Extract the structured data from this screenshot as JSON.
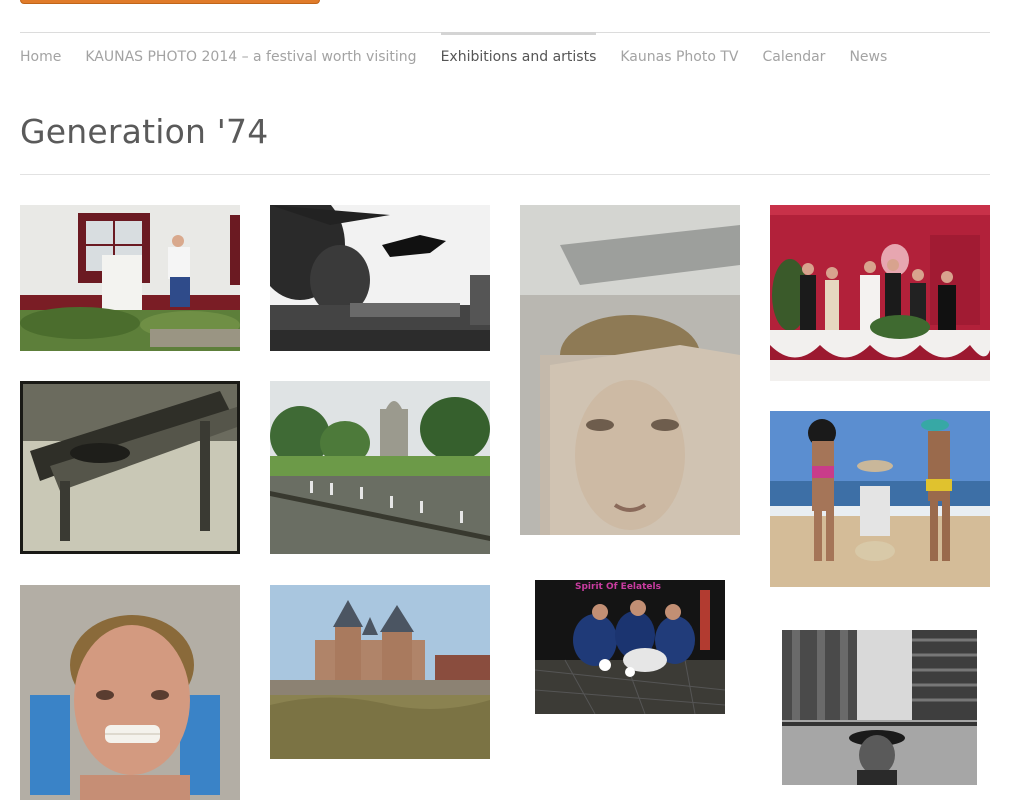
{
  "nav": {
    "items": [
      {
        "label": "Home"
      },
      {
        "label": "KAUNAS PHOTO 2014 – a festival worth visiting"
      },
      {
        "label": "Exhibitions and artists"
      },
      {
        "label": "Kaunas Photo TV"
      },
      {
        "label": "Calendar"
      },
      {
        "label": "News"
      }
    ],
    "active_index": 2
  },
  "page": {
    "title": "Generation '74"
  },
  "gallery": {
    "caption_in_photo": "Spirit Of Eelatels"
  }
}
